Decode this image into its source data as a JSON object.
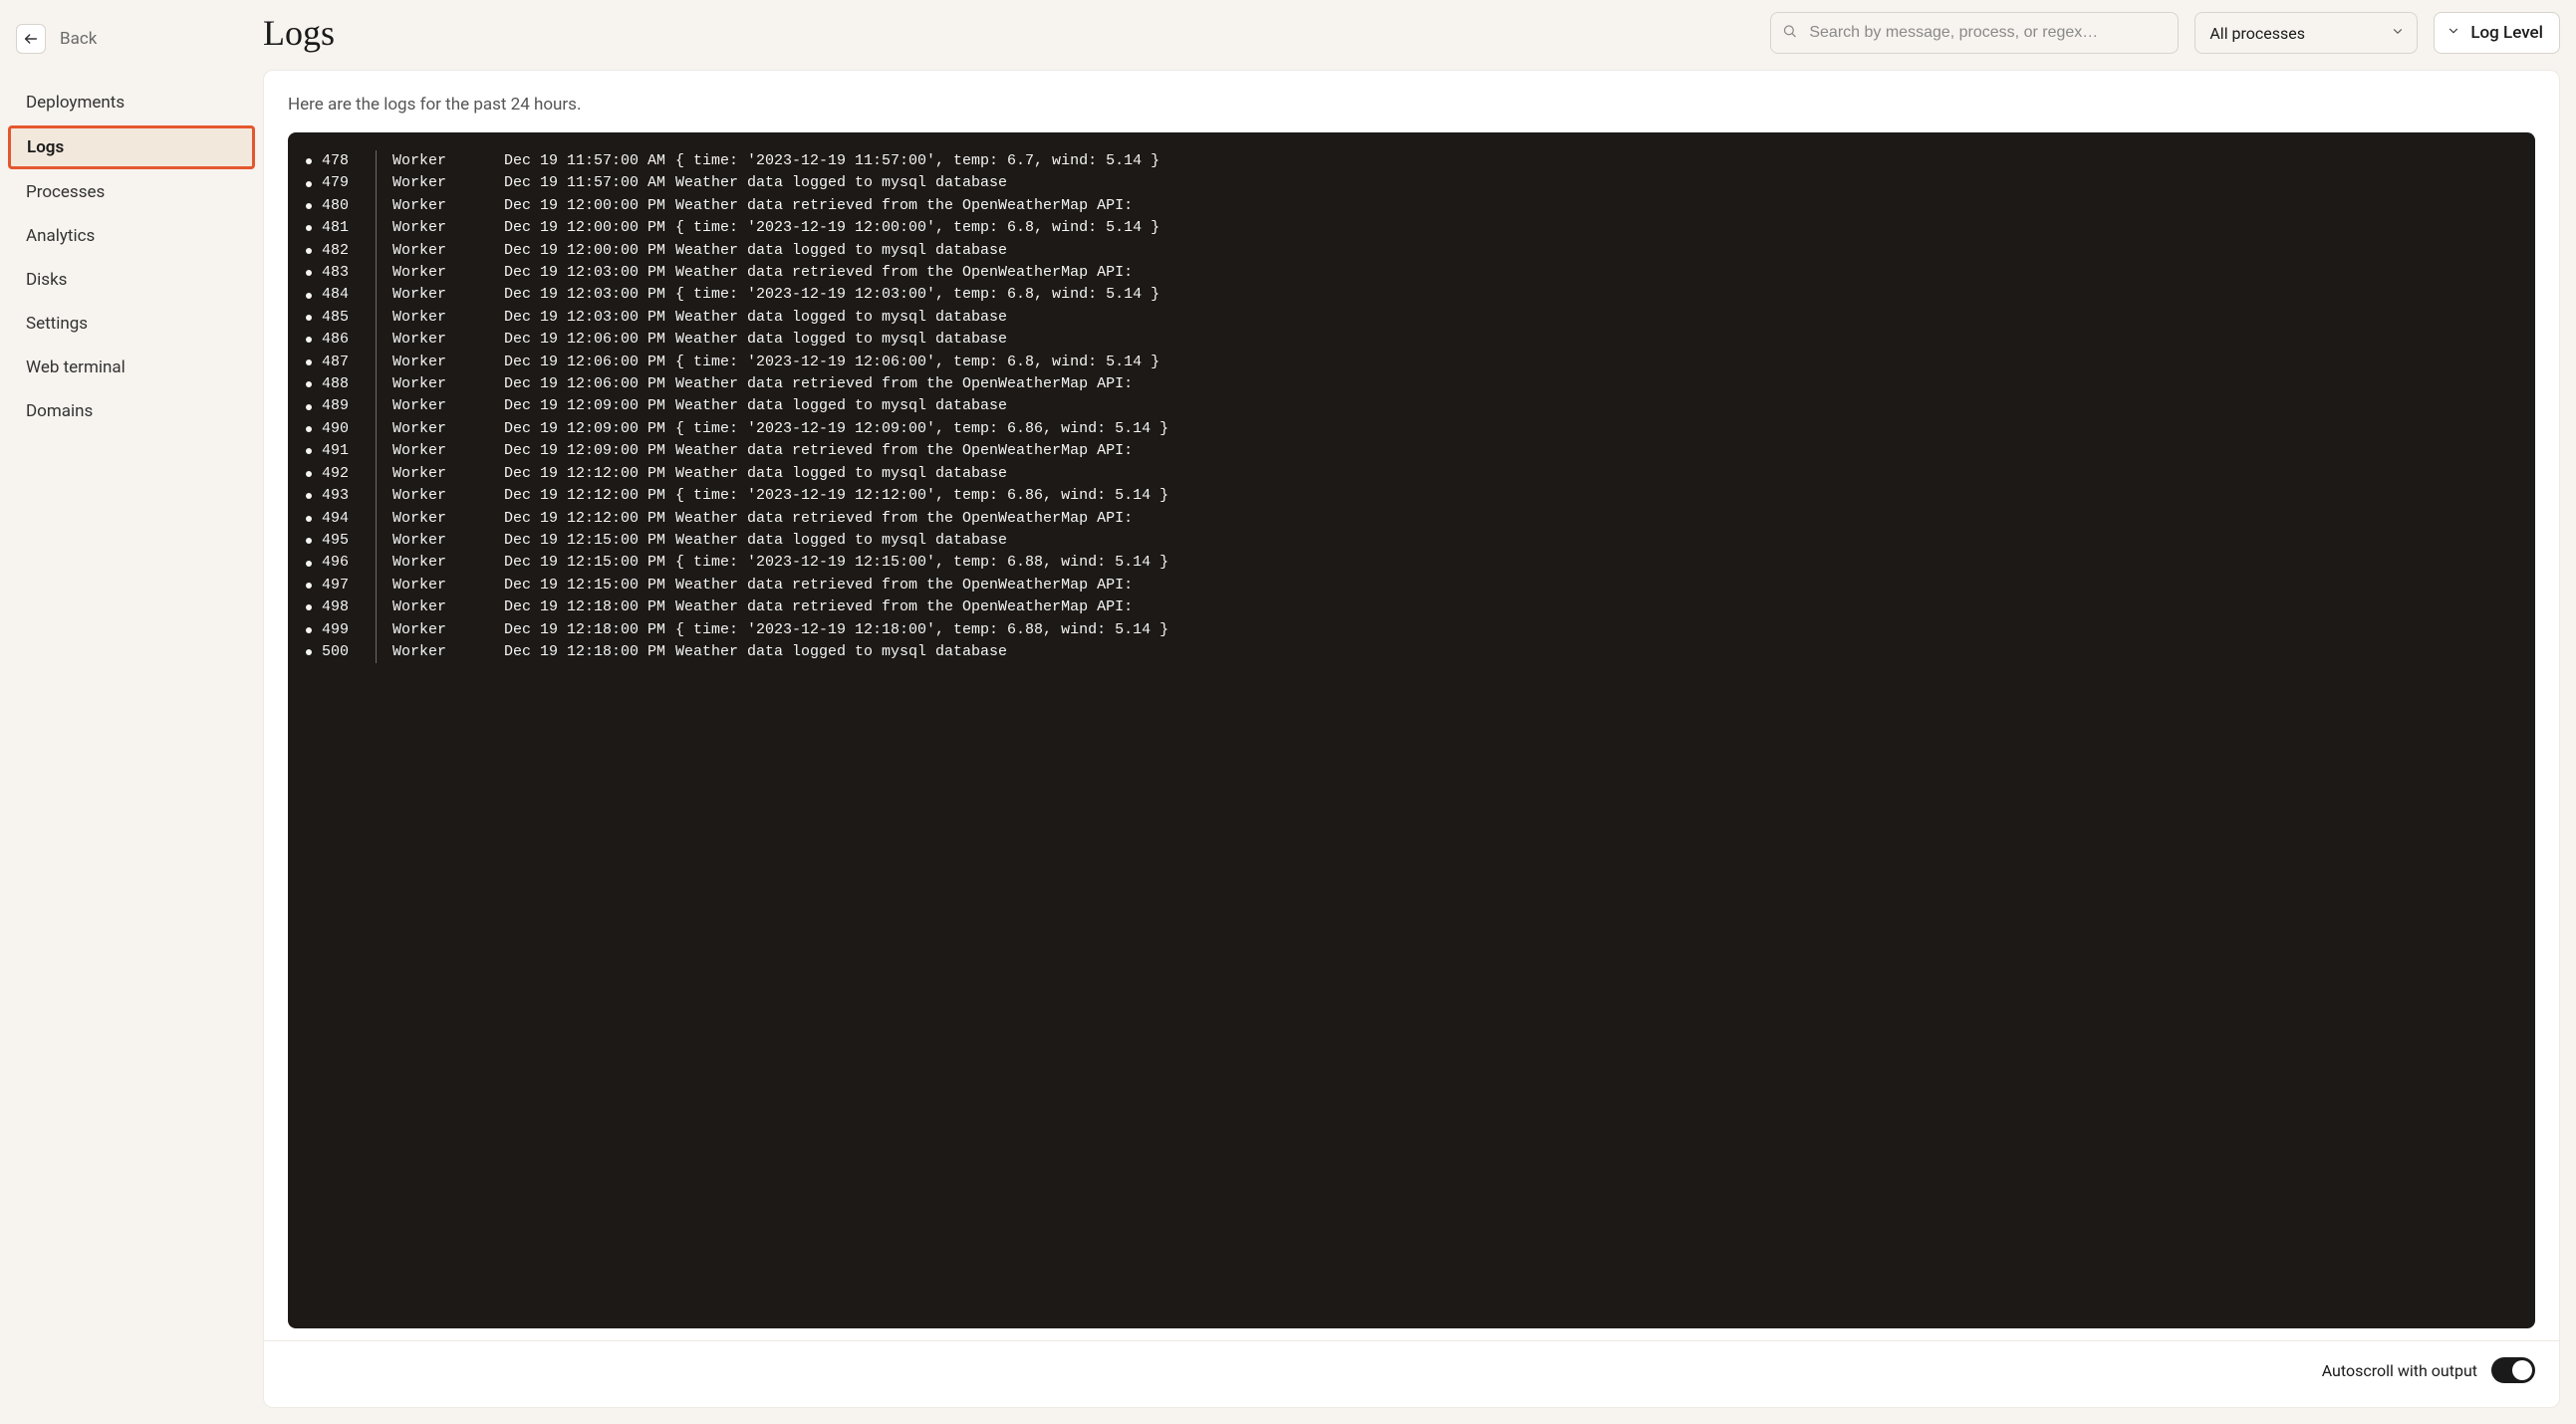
{
  "back_label": "Back",
  "page_title": "Logs",
  "search_placeholder": "Search by message, process, or regex…",
  "process_filter_label": "All processes",
  "loglevel_label": "Log Level",
  "subtitle": "Here are the logs for the past 24 hours.",
  "autoscroll_label": "Autoscroll with output",
  "sidebar": {
    "items": [
      {
        "label": "Deployments",
        "active": false
      },
      {
        "label": "Logs",
        "active": true
      },
      {
        "label": "Processes",
        "active": false
      },
      {
        "label": "Analytics",
        "active": false
      },
      {
        "label": "Disks",
        "active": false
      },
      {
        "label": "Settings",
        "active": false
      },
      {
        "label": "Web terminal",
        "active": false
      },
      {
        "label": "Domains",
        "active": false
      }
    ]
  },
  "logs": [
    {
      "n": "478",
      "proc": "Worker",
      "ts": "Dec 19 11:57:00 AM",
      "msg": "{ time: '2023-12-19 11:57:00', temp: 6.7, wind: 5.14 }"
    },
    {
      "n": "479",
      "proc": "Worker",
      "ts": "Dec 19 11:57:00 AM",
      "msg": "Weather data logged to mysql database"
    },
    {
      "n": "480",
      "proc": "Worker",
      "ts": "Dec 19 12:00:00 PM",
      "msg": "Weather data retrieved from the OpenWeatherMap API:"
    },
    {
      "n": "481",
      "proc": "Worker",
      "ts": "Dec 19 12:00:00 PM",
      "msg": "{ time: '2023-12-19 12:00:00', temp: 6.8, wind: 5.14 }"
    },
    {
      "n": "482",
      "proc": "Worker",
      "ts": "Dec 19 12:00:00 PM",
      "msg": "Weather data logged to mysql database"
    },
    {
      "n": "483",
      "proc": "Worker",
      "ts": "Dec 19 12:03:00 PM",
      "msg": "Weather data retrieved from the OpenWeatherMap API:"
    },
    {
      "n": "484",
      "proc": "Worker",
      "ts": "Dec 19 12:03:00 PM",
      "msg": "{ time: '2023-12-19 12:03:00', temp: 6.8, wind: 5.14 }"
    },
    {
      "n": "485",
      "proc": "Worker",
      "ts": "Dec 19 12:03:00 PM",
      "msg": "Weather data logged to mysql database"
    },
    {
      "n": "486",
      "proc": "Worker",
      "ts": "Dec 19 12:06:00 PM",
      "msg": "Weather data logged to mysql database"
    },
    {
      "n": "487",
      "proc": "Worker",
      "ts": "Dec 19 12:06:00 PM",
      "msg": "{ time: '2023-12-19 12:06:00', temp: 6.8, wind: 5.14 }"
    },
    {
      "n": "488",
      "proc": "Worker",
      "ts": "Dec 19 12:06:00 PM",
      "msg": "Weather data retrieved from the OpenWeatherMap API:"
    },
    {
      "n": "489",
      "proc": "Worker",
      "ts": "Dec 19 12:09:00 PM",
      "msg": "Weather data logged to mysql database"
    },
    {
      "n": "490",
      "proc": "Worker",
      "ts": "Dec 19 12:09:00 PM",
      "msg": "{ time: '2023-12-19 12:09:00', temp: 6.86, wind: 5.14 }"
    },
    {
      "n": "491",
      "proc": "Worker",
      "ts": "Dec 19 12:09:00 PM",
      "msg": "Weather data retrieved from the OpenWeatherMap API:"
    },
    {
      "n": "492",
      "proc": "Worker",
      "ts": "Dec 19 12:12:00 PM",
      "msg": "Weather data logged to mysql database"
    },
    {
      "n": "493",
      "proc": "Worker",
      "ts": "Dec 19 12:12:00 PM",
      "msg": "{ time: '2023-12-19 12:12:00', temp: 6.86, wind: 5.14 }"
    },
    {
      "n": "494",
      "proc": "Worker",
      "ts": "Dec 19 12:12:00 PM",
      "msg": "Weather data retrieved from the OpenWeatherMap API:"
    },
    {
      "n": "495",
      "proc": "Worker",
      "ts": "Dec 19 12:15:00 PM",
      "msg": "Weather data logged to mysql database"
    },
    {
      "n": "496",
      "proc": "Worker",
      "ts": "Dec 19 12:15:00 PM",
      "msg": "{ time: '2023-12-19 12:15:00', temp: 6.88, wind: 5.14 }"
    },
    {
      "n": "497",
      "proc": "Worker",
      "ts": "Dec 19 12:15:00 PM",
      "msg": "Weather data retrieved from the OpenWeatherMap API:"
    },
    {
      "n": "498",
      "proc": "Worker",
      "ts": "Dec 19 12:18:00 PM",
      "msg": "Weather data retrieved from the OpenWeatherMap API:"
    },
    {
      "n": "499",
      "proc": "Worker",
      "ts": "Dec 19 12:18:00 PM",
      "msg": "{ time: '2023-12-19 12:18:00', temp: 6.88, wind: 5.14 }"
    },
    {
      "n": "500",
      "proc": "Worker",
      "ts": "Dec 19 12:18:00 PM",
      "msg": "Weather data logged to mysql database"
    }
  ]
}
